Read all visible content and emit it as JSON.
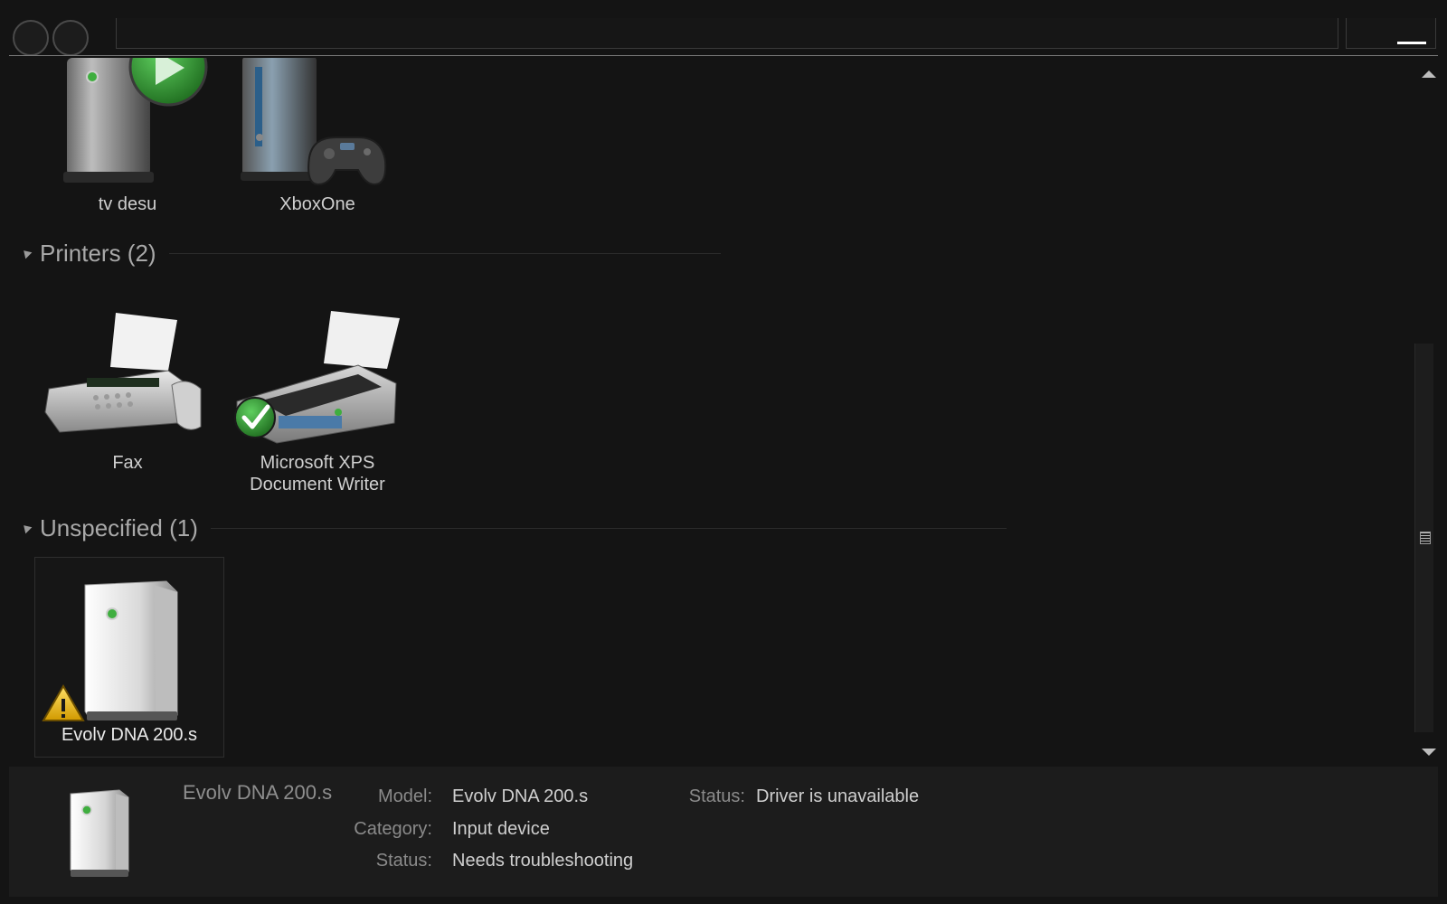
{
  "groups": {
    "devices": {
      "items": [
        {
          "label": "tv desu"
        },
        {
          "label": "XboxOne"
        }
      ]
    },
    "printers": {
      "title": "Printers (2)",
      "items": [
        {
          "label": "Fax"
        },
        {
          "label_line1": "Microsoft XPS",
          "label_line2": "Document Writer"
        }
      ]
    },
    "unspecified": {
      "title": "Unspecified (1)",
      "items": [
        {
          "label": "Evolv DNA 200.s"
        }
      ]
    }
  },
  "details": {
    "name": "Evolv DNA 200.s",
    "model_key": "Model:",
    "model_val": "Evolv DNA 200.s",
    "category_key": "Category:",
    "category_val": "Input device",
    "status_key": "Status:",
    "status_val": "Needs troubleshooting",
    "status2_key": "Status:",
    "status2_val": "Driver is unavailable"
  },
  "icons": {
    "play": "play-icon",
    "gamepad": "gamepad-icon",
    "check": "check-badge-icon",
    "warning": "warning-icon"
  },
  "colors": {
    "background": "#141414",
    "details_pane": "#1c1c1c",
    "status_ok": "#2f9e2f"
  }
}
